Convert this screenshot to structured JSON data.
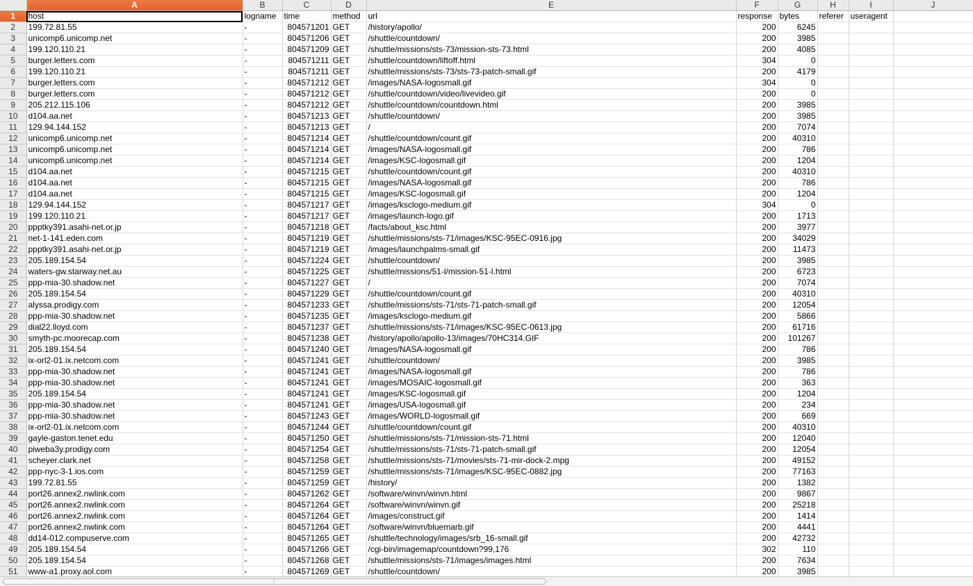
{
  "columns": [
    "A",
    "B",
    "C",
    "D",
    "E",
    "F",
    "G",
    "H",
    "I",
    "J"
  ],
  "selected_column": "A",
  "selected_row": 1,
  "headers": [
    "host",
    "logname",
    "time",
    "method",
    "url",
    "response",
    "bytes",
    "referer",
    "useragent",
    ""
  ],
  "rows": [
    [
      "199.72.81.55",
      "-",
      "804571201",
      "GET",
      "/history/apollo/",
      "200",
      "6245"
    ],
    [
      "unicomp6.unicomp.net",
      "-",
      "804571206",
      "GET",
      "/shuttle/countdown/",
      "200",
      "3985"
    ],
    [
      "199.120.110.21",
      "-",
      "804571209",
      "GET",
      "/shuttle/missions/sts-73/mission-sts-73.html",
      "200",
      "4085"
    ],
    [
      "burger.letters.com",
      "-",
      "804571211",
      "GET",
      "/shuttle/countdown/liftoff.html",
      "304",
      "0"
    ],
    [
      "199.120.110.21",
      "-",
      "804571211",
      "GET",
      "/shuttle/missions/sts-73/sts-73-patch-small.gif",
      "200",
      "4179"
    ],
    [
      "burger.letters.com",
      "-",
      "804571212",
      "GET",
      "/images/NASA-logosmall.gif",
      "304",
      "0"
    ],
    [
      "burger.letters.com",
      "-",
      "804571212",
      "GET",
      "/shuttle/countdown/video/livevideo.gif",
      "200",
      "0"
    ],
    [
      "205.212.115.106",
      "-",
      "804571212",
      "GET",
      "/shuttle/countdown/countdown.html",
      "200",
      "3985"
    ],
    [
      "d104.aa.net",
      "-",
      "804571213",
      "GET",
      "/shuttle/countdown/",
      "200",
      "3985"
    ],
    [
      "129.94.144.152",
      "-",
      "804571213",
      "GET",
      "/",
      "200",
      "7074"
    ],
    [
      "unicomp6.unicomp.net",
      "-",
      "804571214",
      "GET",
      "/shuttle/countdown/count.gif",
      "200",
      "40310"
    ],
    [
      "unicomp6.unicomp.net",
      "-",
      "804571214",
      "GET",
      "/images/NASA-logosmall.gif",
      "200",
      "786"
    ],
    [
      "unicomp6.unicomp.net",
      "-",
      "804571214",
      "GET",
      "/images/KSC-logosmall.gif",
      "200",
      "1204"
    ],
    [
      "d104.aa.net",
      "-",
      "804571215",
      "GET",
      "/shuttle/countdown/count.gif",
      "200",
      "40310"
    ],
    [
      "d104.aa.net",
      "-",
      "804571215",
      "GET",
      "/images/NASA-logosmall.gif",
      "200",
      "786"
    ],
    [
      "d104.aa.net",
      "-",
      "804571215",
      "GET",
      "/images/KSC-logosmall.gif",
      "200",
      "1204"
    ],
    [
      "129.94.144.152",
      "-",
      "804571217",
      "GET",
      "/images/ksclogo-medium.gif",
      "304",
      "0"
    ],
    [
      "199.120.110.21",
      "-",
      "804571217",
      "GET",
      "/images/launch-logo.gif",
      "200",
      "1713"
    ],
    [
      "ppptky391.asahi-net.or.jp",
      "-",
      "804571218",
      "GET",
      "/facts/about_ksc.html",
      "200",
      "3977"
    ],
    [
      "net-1-141.eden.com",
      "-",
      "804571219",
      "GET",
      "/shuttle/missions/sts-71/images/KSC-95EC-0916.jpg",
      "200",
      "34029"
    ],
    [
      "ppptky391.asahi-net.or.jp",
      "-",
      "804571219",
      "GET",
      "/images/launchpalms-small.gif",
      "200",
      "11473"
    ],
    [
      "205.189.154.54",
      "-",
      "804571224",
      "GET",
      "/shuttle/countdown/",
      "200",
      "3985"
    ],
    [
      "waters-gw.starway.net.au",
      "-",
      "804571225",
      "GET",
      "/shuttle/missions/51-l/mission-51-l.html",
      "200",
      "6723"
    ],
    [
      "ppp-mia-30.shadow.net",
      "-",
      "804571227",
      "GET",
      "/",
      "200",
      "7074"
    ],
    [
      "205.189.154.54",
      "-",
      "804571229",
      "GET",
      "/shuttle/countdown/count.gif",
      "200",
      "40310"
    ],
    [
      "alyssa.prodigy.com",
      "-",
      "804571233",
      "GET",
      "/shuttle/missions/sts-71/sts-71-patch-small.gif",
      "200",
      "12054"
    ],
    [
      "ppp-mia-30.shadow.net",
      "-",
      "804571235",
      "GET",
      "/images/ksclogo-medium.gif",
      "200",
      "5866"
    ],
    [
      "dial22.lloyd.com",
      "-",
      "804571237",
      "GET",
      "/shuttle/missions/sts-71/images/KSC-95EC-0613.jpg",
      "200",
      "61716"
    ],
    [
      "smyth-pc.moorecap.com",
      "-",
      "804571238",
      "GET",
      "/history/apollo/apollo-13/images/70HC314.GIF",
      "200",
      "101267"
    ],
    [
      "205.189.154.54",
      "-",
      "804571240",
      "GET",
      "/images/NASA-logosmall.gif",
      "200",
      "786"
    ],
    [
      "ix-orl2-01.ix.netcom.com",
      "-",
      "804571241",
      "GET",
      "/shuttle/countdown/",
      "200",
      "3985"
    ],
    [
      "ppp-mia-30.shadow.net",
      "-",
      "804571241",
      "GET",
      "/images/NASA-logosmall.gif",
      "200",
      "786"
    ],
    [
      "ppp-mia-30.shadow.net",
      "-",
      "804571241",
      "GET",
      "/images/MOSAIC-logosmall.gif",
      "200",
      "363"
    ],
    [
      "205.189.154.54",
      "-",
      "804571241",
      "GET",
      "/images/KSC-logosmall.gif",
      "200",
      "1204"
    ],
    [
      "ppp-mia-30.shadow.net",
      "-",
      "804571241",
      "GET",
      "/images/USA-logosmall.gif",
      "200",
      "234"
    ],
    [
      "ppp-mia-30.shadow.net",
      "-",
      "804571243",
      "GET",
      "/images/WORLD-logosmall.gif",
      "200",
      "669"
    ],
    [
      "ix-orl2-01.ix.netcom.com",
      "-",
      "804571244",
      "GET",
      "/shuttle/countdown/count.gif",
      "200",
      "40310"
    ],
    [
      "gayle-gaston.tenet.edu",
      "-",
      "804571250",
      "GET",
      "/shuttle/missions/sts-71/mission-sts-71.html",
      "200",
      "12040"
    ],
    [
      "piweba3y.prodigy.com",
      "-",
      "804571254",
      "GET",
      "/shuttle/missions/sts-71/sts-71-patch-small.gif",
      "200",
      "12054"
    ],
    [
      "scheyer.clark.net",
      "-",
      "804571258",
      "GET",
      "/shuttle/missions/sts-71/movies/sts-71-mir-dock-2.mpg",
      "200",
      "49152"
    ],
    [
      "ppp-nyc-3-1.ios.com",
      "-",
      "804571259",
      "GET",
      "/shuttle/missions/sts-71/images/KSC-95EC-0882.jpg",
      "200",
      "77163"
    ],
    [
      "199.72.81.55",
      "-",
      "804571259",
      "GET",
      "/history/",
      "200",
      "1382"
    ],
    [
      "port26.annex2.nwlink.com",
      "-",
      "804571262",
      "GET",
      "/software/winvn/winvn.html",
      "200",
      "9867"
    ],
    [
      "port26.annex2.nwlink.com",
      "-",
      "804571264",
      "GET",
      "/software/winvn/winvn.gif",
      "200",
      "25218"
    ],
    [
      "port26.annex2.nwlink.com",
      "-",
      "804571264",
      "GET",
      "/images/construct.gif",
      "200",
      "1414"
    ],
    [
      "port26.annex2.nwlink.com",
      "-",
      "804571264",
      "GET",
      "/software/winvn/bluemarb.gif",
      "200",
      "4441"
    ],
    [
      "dd14-012.compuserve.com",
      "-",
      "804571265",
      "GET",
      "/shuttle/technology/images/srb_16-small.gif",
      "200",
      "42732"
    ],
    [
      "205.189.154.54",
      "-",
      "804571266",
      "GET",
      "/cgi-bin/imagemap/countdown?99,176",
      "302",
      "110"
    ],
    [
      "205.189.154.54",
      "-",
      "804571268",
      "GET",
      "/shuttle/missions/sts-71/images/images.html",
      "200",
      "7634"
    ],
    [
      "www-a1.proxy.aol.com",
      "-",
      "804571269",
      "GET",
      "/shuttle/countdown/",
      "200",
      "3985"
    ]
  ],
  "scrollbar": {
    "grip": "⁞"
  }
}
